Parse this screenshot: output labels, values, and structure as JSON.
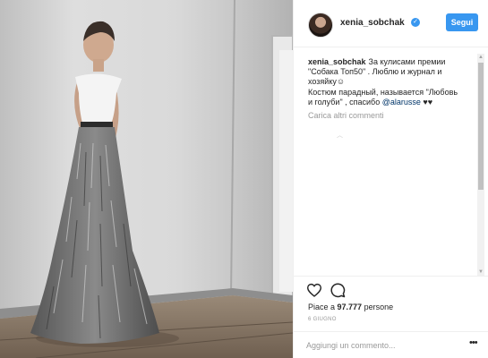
{
  "post": {
    "photo_label": "photo-of-woman-in-white-top-and-feathered-skirt",
    "header": {
      "username": "xenia_sobchak",
      "verified_icon": "verified-badge-icon",
      "follow_label": "Segui"
    },
    "caption": {
      "author": "xenia_sobchak",
      "line1": "За кулисами премии",
      "line2": "\"Собака Топ50\" . Люблю и журнал и",
      "line3": "хозяйку☺",
      "line4": "Костюм парадный, называется \"Любовь",
      "line5a": "и голуби\" , спасибо ",
      "mention": "@alarusse",
      "line5b": " ♥♥"
    },
    "load_more_comments": "Carica altri commenti",
    "likes": {
      "prefix": "Piace a ",
      "count": "97.777",
      "suffix": " persone"
    },
    "date": "6 GIUGNO",
    "comment_input": {
      "placeholder": "Aggiungi un commento...",
      "value": ""
    },
    "options_label": "•••"
  },
  "colors": {
    "accent_blue": "#3897f0",
    "text": "#262626",
    "muted": "#999999",
    "border": "#efefef"
  }
}
